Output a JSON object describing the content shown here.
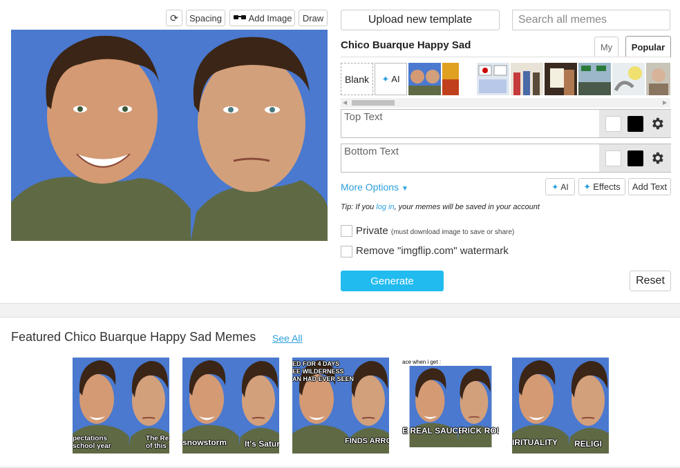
{
  "toolbar": {
    "rotate_icon": "rotate-icon",
    "spacing_label": "Spacing",
    "add_image_label": "Add Image",
    "draw_label": "Draw"
  },
  "editor": {
    "upload_label": "Upload new template",
    "search_placeholder": "Search all memes",
    "template_title": "Chico Buarque Happy Sad",
    "tab_my": "My",
    "tab_popular": "Popular",
    "blank_label": "Blank",
    "ai_tile_label": "AI",
    "top_text_placeholder": "Top Text",
    "bottom_text_placeholder": "Bottom Text",
    "more_options": "More Options",
    "ai_button": "AI",
    "effects_button": "Effects",
    "add_text_button": "Add Text",
    "tip_prefix": "Tip: If you ",
    "tip_link": "log in",
    "tip_suffix": ", your memes will be saved in your account",
    "private_label": "Private",
    "private_note": "(must download image to save or share)",
    "watermark_label": "Remove \"imgflip.com\" watermark",
    "generate_label": "Generate",
    "reset_label": "Reset"
  },
  "featured": {
    "title": "Featured Chico Buarque Happy Sad Memes",
    "see_all": "See All",
    "items": [
      {
        "cap_left": "pectations\nschool year",
        "cap_right": "The Real\nof this scho"
      },
      {
        "cap_left": "snowstorm",
        "cap_right": "It's Satur"
      },
      {
        "cap_top": "ED FOR 4 DAYS\nEE WILDERNESS\nAN HAD EVER SEEN",
        "cap_right": "FINDS ARROW"
      },
      {
        "cap_top": "ace when i get :",
        "cap_left": "E REAL SAUCE",
        "cap_right": "RICK ROLL"
      },
      {
        "cap_left": "IRITUALITY",
        "cap_right": "RELIGI"
      }
    ]
  },
  "colors": {
    "accent": "#22bbf0",
    "link": "#2b9fdc",
    "meme_bg": "#4a79cf"
  }
}
